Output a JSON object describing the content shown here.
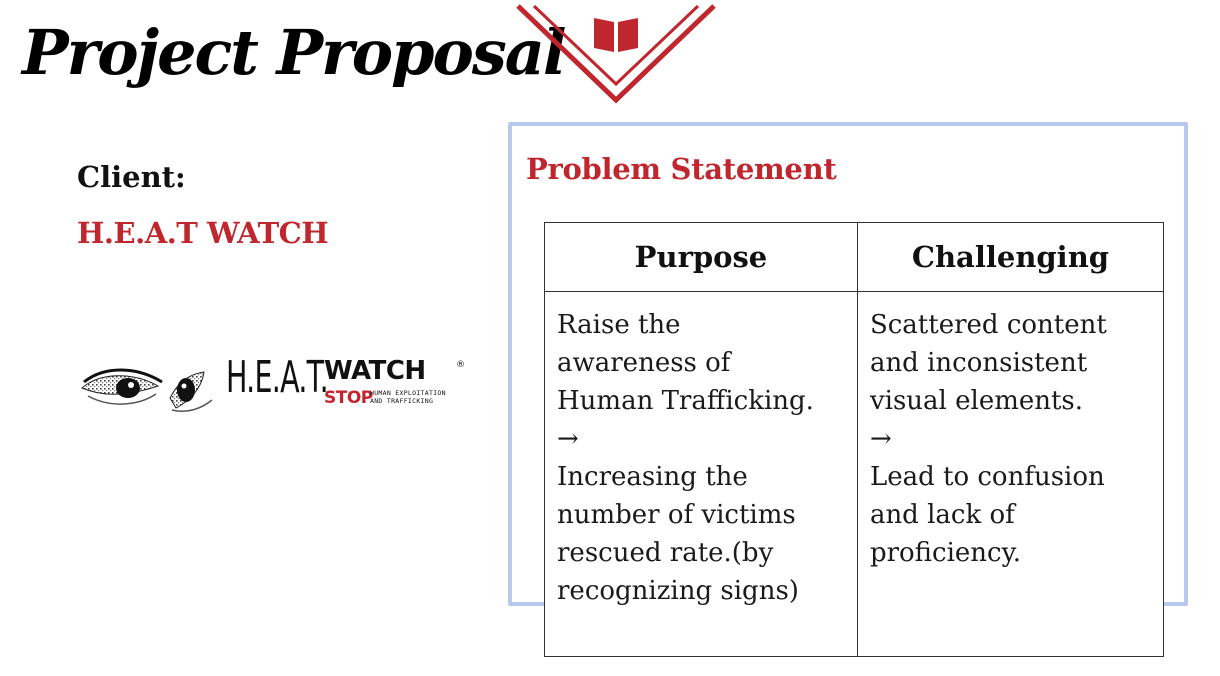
{
  "slide": {
    "title": "Project Proposal",
    "icon": "book-icon"
  },
  "client": {
    "label": "Client:",
    "name": "H.E.A.T WATCH"
  },
  "logo": {
    "heat": "H.E.A.T.",
    "watch": "WATCH",
    "registered": "®",
    "stop": "STOP",
    "tagline_1": "HUMAN EXPLOITATION",
    "tagline_2": "AND TRAFFICKING"
  },
  "problem": {
    "heading": "Problem Statement",
    "columns": [
      "Purpose",
      "Challenging"
    ],
    "purpose_lines": [
      "Raise the",
      "awareness of",
      "Human Trafficking.",
      "→",
      "Increasing the",
      "number of victims",
      "rescued rate.(by",
      "recognizing signs)"
    ],
    "challenging_lines": [
      "Scattered content",
      "and inconsistent",
      "visual elements.",
      "→",
      "Lead to confusion",
      "and lack of",
      "proficiency."
    ]
  },
  "colors": {
    "accent_red": "#c0262d",
    "panel_border": "#b7c9ec"
  }
}
